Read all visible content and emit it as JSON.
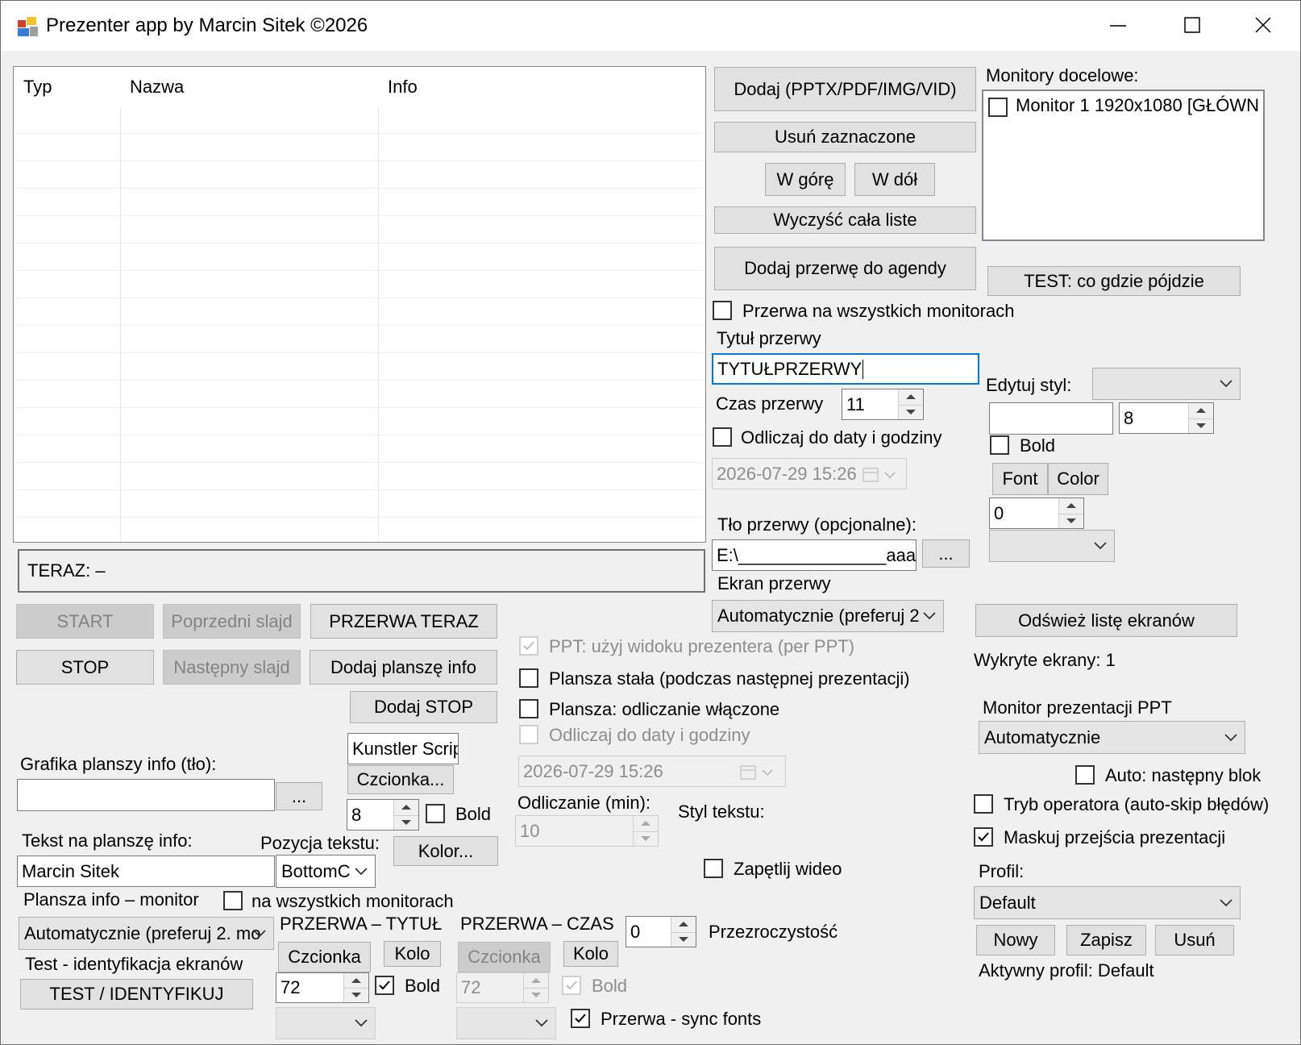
{
  "window": {
    "title": "Prezenter app by Marcin Sitek ©2026"
  },
  "list": {
    "columns": [
      "Typ",
      "Nazwa",
      "Info"
    ]
  },
  "now_playing": "TERAZ: –",
  "buttons": {
    "add_files": "Dodaj (PPTX/PDF/IMG/VID)",
    "remove_selected": "Usuń zaznaczone",
    "move_up": "W górę",
    "move_down": "W dół",
    "clear_list": "Wyczyść cała liste",
    "add_break": "Dodaj przerwę do agendy",
    "test_where": "TEST: co gdzie pójdzie",
    "browse_bg": "...",
    "refresh_screens": "Odśwież listę ekranów",
    "start": "START",
    "prev_slide": "Poprzedni slajd",
    "break_now": "PRZERWA TERAZ",
    "stop": "STOP",
    "next_slide": "Następny slajd",
    "add_info": "Dodaj planszę info",
    "add_stop": "Dodaj STOP",
    "font_info": "Czcionka...",
    "color_info": "Kolor...",
    "browse_info": "...",
    "test_identify": "TEST / IDENTYFIKUJ",
    "title_font": "Czcionka",
    "title_color": "Kolo",
    "time_font": "Czcionka",
    "time_color": "Kolo",
    "style_font": "Font",
    "style_color": "Color",
    "profile_new": "Nowy",
    "profile_save": "Zapisz",
    "profile_delete": "Usuń"
  },
  "monitors": {
    "label": "Monitory docelowe:",
    "items": [
      {
        "label": "Monitor 1  1920x1080 [GŁÓWN",
        "checked": false
      }
    ]
  },
  "break": {
    "all_monitors_label": "Przerwa na wszystkich monitorach",
    "title_label": "Tytuł przerwy",
    "title_value": "TYTUŁPRZERWY",
    "duration_label": "Czas przerwy",
    "duration_value": "11",
    "countdown_date_label": "Odliczaj do daty i godziny",
    "datetime_value": "2026-07-29 15:26",
    "bg_label": "Tło przerwy (opcjonalne):",
    "bg_value": "E:\\_______________aaa",
    "screen_label": "Ekran przerwy",
    "screen_value": "Automatycznie (preferuj 2"
  },
  "style": {
    "label": "Edytuj styl:",
    "combo_value": "",
    "text_value": "",
    "size_value": "8",
    "bold_label": "Bold",
    "offset_value": "0",
    "combo2_value": ""
  },
  "screens": {
    "detected": "Wykryte ekrany: 1",
    "ppt_monitor_label": "Monitor prezentacji PPT",
    "ppt_monitor_value": "Automatycznie",
    "auto_next_label": "Auto: następny blok",
    "operator_label": "Tryb operatora (auto-skip błędów)",
    "mask_label": "Maskuj przejścia prezentacji"
  },
  "profile": {
    "label": "Profil:",
    "value": "Default",
    "active": "Aktywny profil: Default"
  },
  "ppt": {
    "presenter_view_label": "PPT: użyj widoku prezentera (per PPT)",
    "fixed_board_label": "Plansza stała (podczas następnej prezentacji)",
    "board_countdown_label": "Plansza: odliczanie włączone",
    "countdown_date_label": "Odliczaj do daty i godziny",
    "datetime_value": "2026-07-29 15:26",
    "countdown_min_label": "Odliczanie (min):",
    "countdown_min_value": "10",
    "text_style_label": "Styl tekstu:",
    "loop_video_label": "Zapętlij wideo"
  },
  "info": {
    "font_name": "Kunstler Scrip",
    "size_value": "8",
    "bold_label": "Bold",
    "bg_label": "Grafika planszy info (tło):",
    "bg_value": "",
    "text_label": "Tekst na planszę info:",
    "text_value": "Marcin Sitek",
    "position_label": "Pozycja tekstu:",
    "position_value": "BottomC",
    "monitor_label": "Plansza info – monitor",
    "all_monitors_label": "na wszystkich monitorach",
    "monitor_value": "Automatycznie (preferuj 2. mo",
    "test_label": "Test - identyfikacja ekranów"
  },
  "break_title": {
    "label": "PRZERWA – TYTUŁ",
    "size_value": "72",
    "bold_label": "Bold",
    "combo_value": ""
  },
  "break_time": {
    "label": "PRZERWA – CZAS",
    "size_value": "72",
    "bold_label": "Bold",
    "combo_value": ""
  },
  "transparency": {
    "value": "0",
    "label": "Przezroczystość"
  },
  "sync_fonts_label": "Przerwa - sync fonts"
}
